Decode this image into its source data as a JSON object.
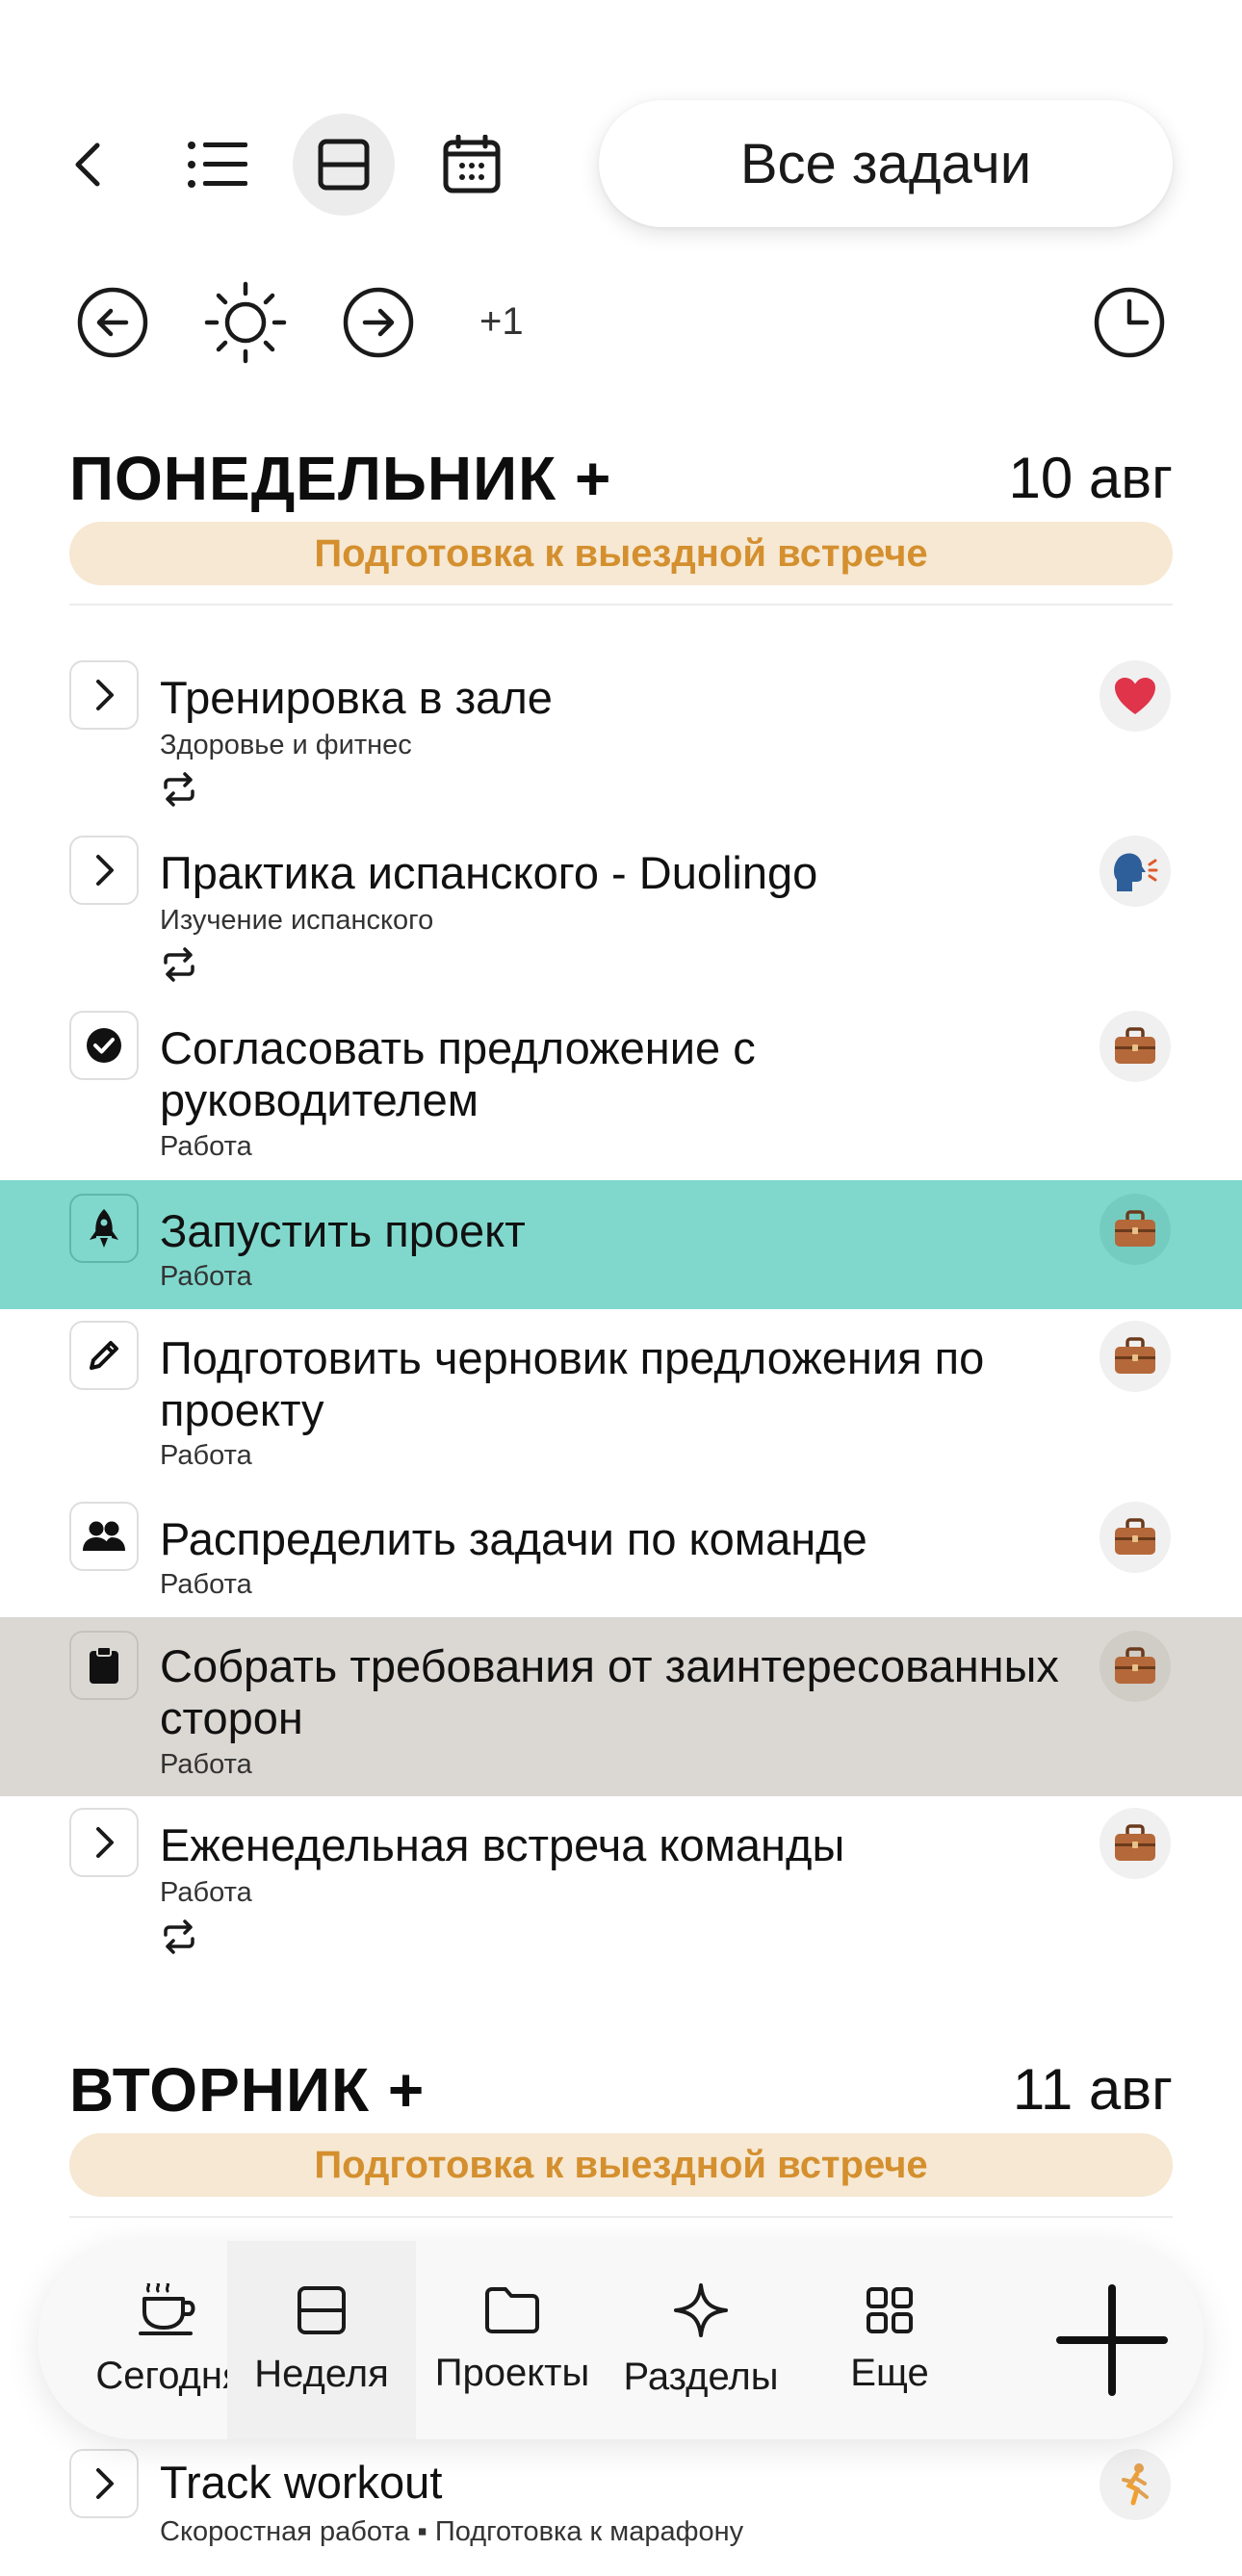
{
  "toolbar": {
    "filter_label": "Все задачи",
    "day_offset": "+1",
    "icons": [
      "back-icon",
      "list-view-icon",
      "week-view-icon",
      "calendar-icon"
    ],
    "nav_icons": [
      "previous-day-icon",
      "today-sun-icon",
      "next-day-icon",
      "clock-icon"
    ]
  },
  "days": [
    {
      "title": "ПОНЕДЕЛЬНИК +",
      "date": "10 авг",
      "banner": "Подготовка к выездной встрече",
      "tasks": [
        {
          "title": "Тренировка в зале",
          "subtitle": "Здоровье и фитнес",
          "status_icon": "chevron-right-icon",
          "category_icon": "heart-icon",
          "repeat": true
        },
        {
          "title": "Практика испанского - Duolingo",
          "subtitle": "Изучение испанского",
          "status_icon": "chevron-right-icon",
          "category_icon": "speaking-head-icon",
          "repeat": true
        },
        {
          "title": "Согласовать предложение с руководителем",
          "subtitle": "Работа",
          "status_icon": "check-circle-icon",
          "category_icon": "briefcase-icon",
          "repeat": false
        },
        {
          "title": "Запустить проект",
          "subtitle": "Работа",
          "status_icon": "rocket-icon",
          "category_icon": "briefcase-icon",
          "repeat": false,
          "highlight": "#80d8cd"
        },
        {
          "title": "Подготовить черновик предложения по проекту",
          "subtitle": "Работа",
          "status_icon": "pencil-icon",
          "category_icon": "briefcase-icon",
          "repeat": false
        },
        {
          "title": "Распределить задачи по команде",
          "subtitle": "Работа",
          "status_icon": "people-icon",
          "category_icon": "briefcase-icon",
          "repeat": false
        },
        {
          "title": "Собрать требования от заинтересованных сторон",
          "subtitle": "Работа",
          "status_icon": "clipboard-icon",
          "category_icon": "briefcase-icon",
          "repeat": false,
          "highlight": "#dbd8d3"
        },
        {
          "title": "Еженедельная встреча команды",
          "subtitle": "Работа",
          "status_icon": "chevron-right-icon",
          "category_icon": "briefcase-icon",
          "repeat": true
        }
      ]
    },
    {
      "title": "ВТОРНИК +",
      "date": "11 авг",
      "banner": "Подготовка к выездной встрече",
      "tasks": [
        {
          "title": "Track workout",
          "subtitle": "Скоростная работа ▪ Подготовка к марафону",
          "status_icon": "chevron-right-icon",
          "category_icon": "runner-icon",
          "repeat": false
        }
      ]
    }
  ],
  "bottom_nav": {
    "items": [
      {
        "label": "Сегодня",
        "icon": "coffee-cup-icon",
        "active": false
      },
      {
        "label": "Неделя",
        "icon": "week-view-icon",
        "active": true
      },
      {
        "label": "Проекты",
        "icon": "folder-icon",
        "active": false
      },
      {
        "label": "Разделы",
        "icon": "sparkle-icon",
        "active": false
      },
      {
        "label": "Еще",
        "icon": "grid-icon",
        "active": false
      }
    ],
    "add_icon": "plus-icon"
  },
  "colors": {
    "accent_highlight": "#80d8cd",
    "selected_row": "#dbd8d3",
    "banner_bg": "#f6e8d2",
    "banner_text": "#d48f2e",
    "heart": "#e0344b",
    "briefcase": "#b5683a"
  }
}
